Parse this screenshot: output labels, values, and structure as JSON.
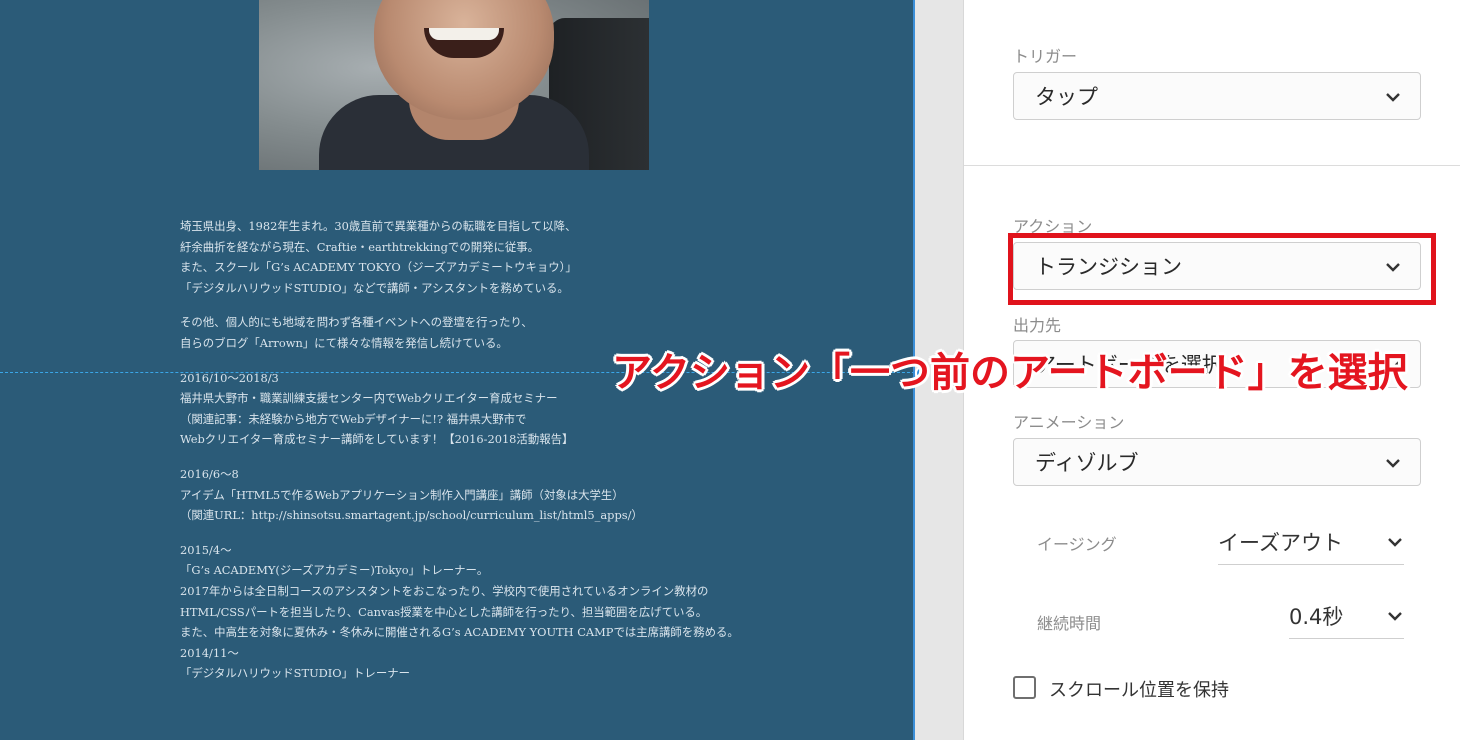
{
  "artboard": {
    "bio_lines": [
      "埼玉県出身、1982年生まれ。30歳直前で異業種からの転職を目指して以降、",
      "紆余曲折を経ながら現在、Craftie・earthtrekkingでの開発に従事。",
      "また、スクール「G’s ACADEMY TOKYO（ジーズアカデミートウキョウ）」",
      "「デジタルハリウッドSTUDIO」などで講師・アシスタントを務めている。",
      "",
      "その他、個人的にも地域を問わず各種イベントへの登壇を行ったり、",
      "自らのブログ「Arrown」にて様々な情報を発信し続けている。",
      "",
      "2016/10〜2018/3",
      "福井県大野市・職業訓練支援センター内でWebクリエイター育成セミナー",
      "（関連記事：未経験から地方でWebデザイナーに!? 福井県大野市で",
      "Webクリエイター育成セミナー講師をしています！【2016-2018活動報告】",
      "",
      "2016/6〜8",
      "アイデム「HTML5で作るWebアプリケーション制作入門講座」講師（対象は大学生）",
      "（関連URL：http://shinsotsu.smartagent.jp/school/curriculum_list/html5_apps/）",
      "",
      "2015/4〜",
      "「G’s ACADEMY(ジーズアカデミー)Tokyo」トレーナー。",
      "2017年からは全日制コースのアシスタントをおこなったり、学校内で使用されているオンライン教材の",
      "HTML/CSSパートを担当したり、Canvas授業を中心とした講師を行ったり、担当範囲を広げている。",
      "また、中高生を対象に夏休み・冬休みに開催されるG’s ACADEMY YOUTH CAMPでは主席講師を務める。",
      "2014/11〜",
      "「デジタルハリウッドSTUDIO」トレーナー"
    ]
  },
  "panel": {
    "trigger_label": "トリガー",
    "trigger_value": "タップ",
    "action_label": "アクション",
    "action_value": "トランジション",
    "destination_label": "出力先",
    "destination_value": "アートボードを選択",
    "animation_label": "アニメーション",
    "animation_value": "ディゾルブ",
    "easing_label": "イージング",
    "easing_value": "イーズアウト",
    "duration_label": "継続時間",
    "duration_value": "0.4秒",
    "preserve_scroll_label": "スクロール位置を保持",
    "preserve_scroll_checked": false
  },
  "annotation": {
    "caption": "アクション「一つ前のアートボード」を選択",
    "color": "#e4151f"
  }
}
